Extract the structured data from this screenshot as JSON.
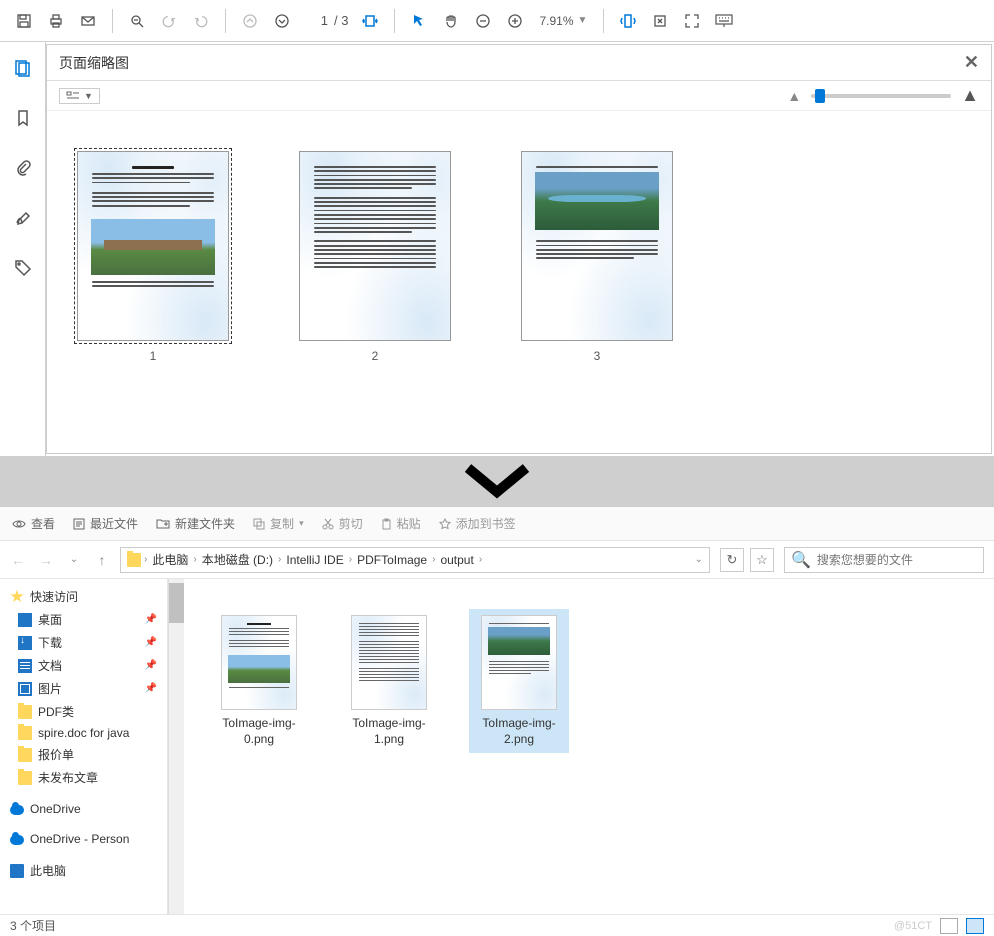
{
  "pdfToolbar": {
    "pageCurrent": "1",
    "pageTotal": "/ 3",
    "zoomValue": "7.91%"
  },
  "thumbPanel": {
    "title": "页面缩略图",
    "pages": [
      "1",
      "2",
      "3"
    ]
  },
  "explorerToolbar": {
    "view": "查看",
    "recent": "最近文件",
    "newFolder": "新建文件夹",
    "copy": "复制",
    "cut": "剪切",
    "paste": "粘贴",
    "bookmark": "添加到书签"
  },
  "breadcrumbs": [
    "此电脑",
    "本地磁盘 (D:)",
    "IntelliJ IDE",
    "PDFToImage",
    "output"
  ],
  "searchPlaceholder": "搜索您想要的文件",
  "sidebar": {
    "quickAccess": "快速访问",
    "desktop": "桌面",
    "downloads": "下载",
    "documents": "文档",
    "pictures": "图片",
    "pdfClass": "PDF类",
    "spire": "spire.doc for java",
    "quote": "报价单",
    "unpub": "未发布文章",
    "onedrive": "OneDrive",
    "onedrivePersonal": "OneDrive - Person",
    "thisPc": "此电脑"
  },
  "files": [
    {
      "name": "ToImage-img-0.png"
    },
    {
      "name": "ToImage-img-1.png"
    },
    {
      "name": "ToImage-img-2.png"
    }
  ],
  "statusBar": {
    "count": "3 个项目",
    "watermark": "@51CT"
  }
}
